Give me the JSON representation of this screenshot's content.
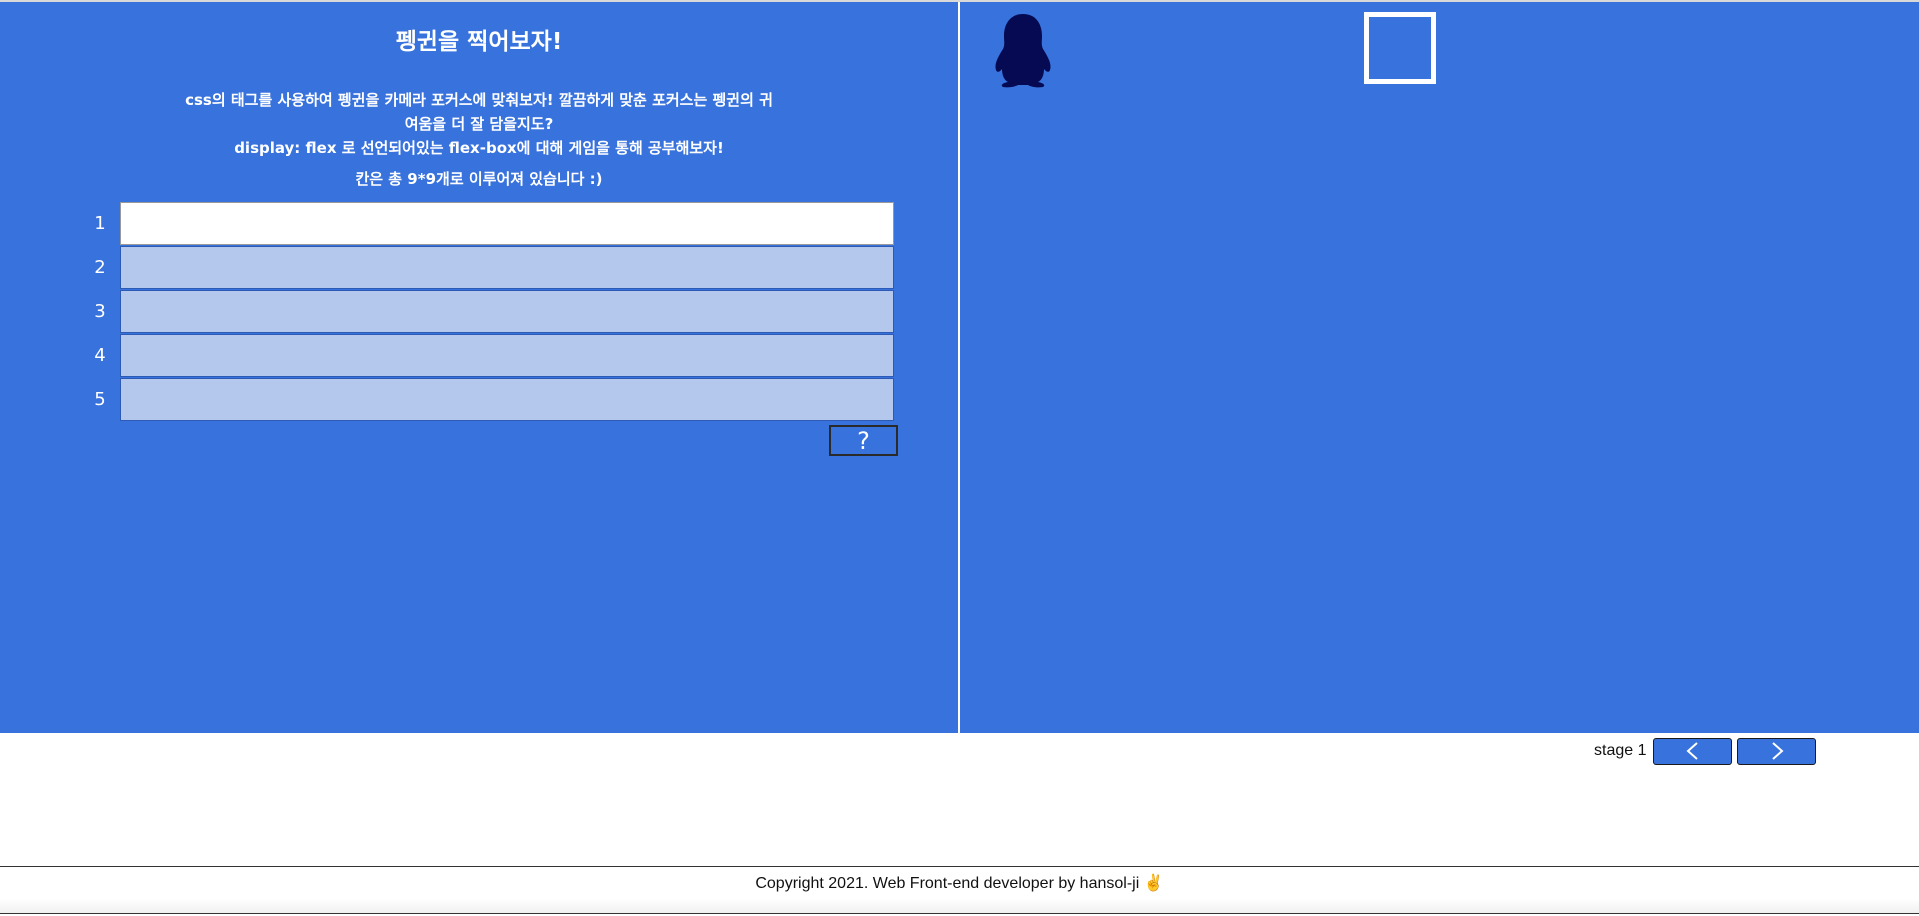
{
  "game": {
    "title": "펭귄을 찍어보자!",
    "desc_line1": "css의 태그를 사용하여 펭귄을 카메라 포커스에 맞춰보자! 깔끔하게 맞춘 포커스는 펭귄의 귀",
    "desc_line2": "여움을 더 잘 담을지도?",
    "desc_line3": "display: flex 로 선언되어있는 flex-box에 대해 게임을 통해 공부해보자!",
    "count_note": "칸은 총 9*9개로 이루어져 있습니다 :)",
    "lines": [
      {
        "number": "1",
        "value": ""
      },
      {
        "number": "2",
        "value": ""
      },
      {
        "number": "3",
        "value": ""
      },
      {
        "number": "4",
        "value": ""
      },
      {
        "number": "5",
        "value": ""
      }
    ],
    "help_label": "?"
  },
  "board": {
    "penguin_icon": "penguin-icon",
    "focus_icon": "camera-focus-frame",
    "penguin_color": "#050a52",
    "focus_color": "#ffffff"
  },
  "stage": {
    "label": "stage 1",
    "prev_icon": "chevron-left-icon",
    "next_icon": "chevron-right-icon"
  },
  "footer": {
    "copyright": "Copyright 2021. Web Front-end developer by hansol-ji ✌️"
  },
  "colors": {
    "panel_bg": "#3872dd",
    "input_disabled_bg": "#b3c8ec",
    "input_active_bg": "#ffffff"
  }
}
